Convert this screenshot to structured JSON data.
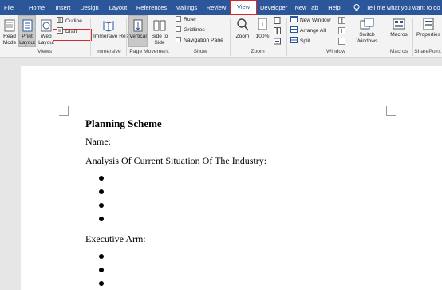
{
  "tabs": [
    {
      "label": "File"
    },
    {
      "label": "Home"
    },
    {
      "label": "Insert"
    },
    {
      "label": "Design"
    },
    {
      "label": "Layout"
    },
    {
      "label": "References"
    },
    {
      "label": "Mailings"
    },
    {
      "label": "Review"
    },
    {
      "label": "View"
    },
    {
      "label": "Developer"
    },
    {
      "label": "New Tab"
    },
    {
      "label": "Help"
    }
  ],
  "tell_me": "Tell me what you want to do",
  "ribbon": {
    "views": {
      "read_mode": "Read Mode",
      "print_layout": "Print Layout",
      "web_layout": "Web Layout",
      "outline": "Outline",
      "draft": "Draft",
      "label": "Views"
    },
    "immersive": {
      "reader": "Immersive Reader",
      "label": "Immersive"
    },
    "page_movement": {
      "vertical": "Vertical",
      "side_to_side": "Side to Side",
      "label": "Page Movement"
    },
    "show": {
      "ruler": "Ruler",
      "gridlines": "Gridlines",
      "navigation_pane": "Navigation Pane",
      "label": "Show"
    },
    "zoom": {
      "zoom": "Zoom",
      "percent": "100%",
      "label": "Zoom"
    },
    "window": {
      "new_window": "New Window",
      "arrange_all": "Arrange All",
      "split": "Split",
      "switch_windows": "Switch Windows",
      "label": "Window"
    },
    "macros": {
      "macros": "Macros",
      "label": "Macros"
    },
    "sharepoint": {
      "properties": "Properties",
      "label": "SharePoint"
    }
  },
  "document": {
    "title": "Planning Scheme",
    "name_line": "Name:",
    "analysis": "Analysis Of Current Situation Of The Industry:",
    "executive": "Executive Arm:"
  }
}
